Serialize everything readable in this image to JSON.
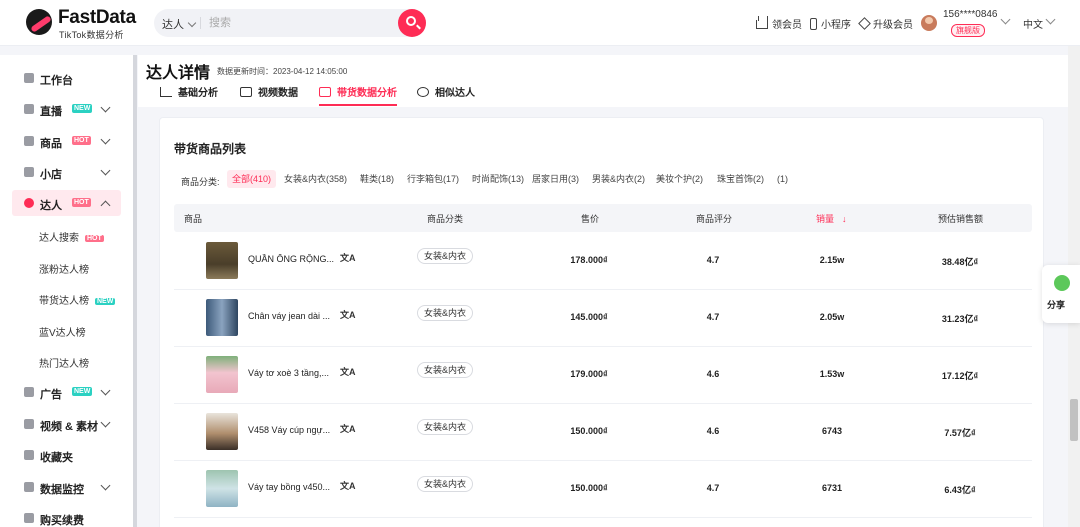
{
  "header": {
    "logo_title": "FastData",
    "logo_subtitle": "TikTok数据分析",
    "search_type": "达人",
    "search_placeholder": "搜索",
    "nav": {
      "vip": "领会员",
      "mini_program": "小程序",
      "upgrade": "升级会员"
    },
    "user_phone": "156****0846",
    "plan_badge": "旗舰版",
    "language": "中文"
  },
  "sidebar": {
    "items": [
      {
        "label": "工作台",
        "tag": ""
      },
      {
        "label": "直播",
        "tag": "NEW"
      },
      {
        "label": "商品",
        "tag": "HOT"
      },
      {
        "label": "小店",
        "tag": ""
      },
      {
        "label": "达人",
        "tag": "HOT"
      },
      {
        "label": "广告",
        "tag": "NEW"
      },
      {
        "label": "视频 & 素材",
        "tag": ""
      },
      {
        "label": "收藏夹",
        "tag": ""
      },
      {
        "label": "数据监控",
        "tag": ""
      },
      {
        "label": "购买续费",
        "tag": ""
      }
    ],
    "sub_items": [
      {
        "label": "达人搜索",
        "tag": "HOT"
      },
      {
        "label": "涨粉达人榜",
        "tag": ""
      },
      {
        "label": "带货达人榜",
        "tag": "NEW"
      },
      {
        "label": "蓝V达人榜",
        "tag": ""
      },
      {
        "label": "热门达人榜",
        "tag": ""
      }
    ]
  },
  "page": {
    "title": "达人详情",
    "update_time": "数据更新时间：2023-04-12 14:05:00",
    "tabs": [
      "基础分析",
      "视频数据",
      "带货数据分析",
      "相似达人"
    ]
  },
  "panel": {
    "title": "带货商品列表",
    "filter_label": "商品分类:",
    "chips": [
      "全部(410)",
      "女装&内衣(358)",
      "鞋类(18)",
      "行李箱包(17)",
      "时尚配饰(13)",
      "居家日用(3)",
      "男装&内衣(2)",
      "美妆个护(2)",
      "珠宝首饰(2)",
      "(1)"
    ],
    "columns": [
      "商品",
      "商品分类",
      "售价",
      "商品评分",
      "销量",
      "预估销售额"
    ],
    "rows": [
      {
        "name": "QUẦN ỐNG RỘNG...",
        "category": "女装&内衣",
        "price": "178.000₫",
        "rating": "4.7",
        "sales": "2.15w",
        "revenue": "38.48亿₫"
      },
      {
        "name": "Chân váy jean dài ...",
        "category": "女装&内衣",
        "price": "145.000₫",
        "rating": "4.7",
        "sales": "2.05w",
        "revenue": "31.23亿₫"
      },
      {
        "name": "Váy tơ xoè 3 tầng,...",
        "category": "女装&内衣",
        "price": "179.000₫",
        "rating": "4.6",
        "sales": "1.53w",
        "revenue": "17.12亿₫"
      },
      {
        "name": "V458 Váy cúp ngự...",
        "category": "女装&内衣",
        "price": "150.000₫",
        "rating": "4.6",
        "sales": "6743",
        "revenue": "7.57亿₫"
      },
      {
        "name": "Váy tay bồng v450...",
        "category": "女装&内衣",
        "price": "150.000₫",
        "rating": "4.7",
        "sales": "6731",
        "revenue": "6.43亿₫"
      }
    ]
  },
  "share": {
    "label": "分享"
  },
  "colors": {
    "accent": "#fe2c55",
    "new_tag": "#2bd1c2",
    "hot_tag": "#ff6f8a"
  }
}
